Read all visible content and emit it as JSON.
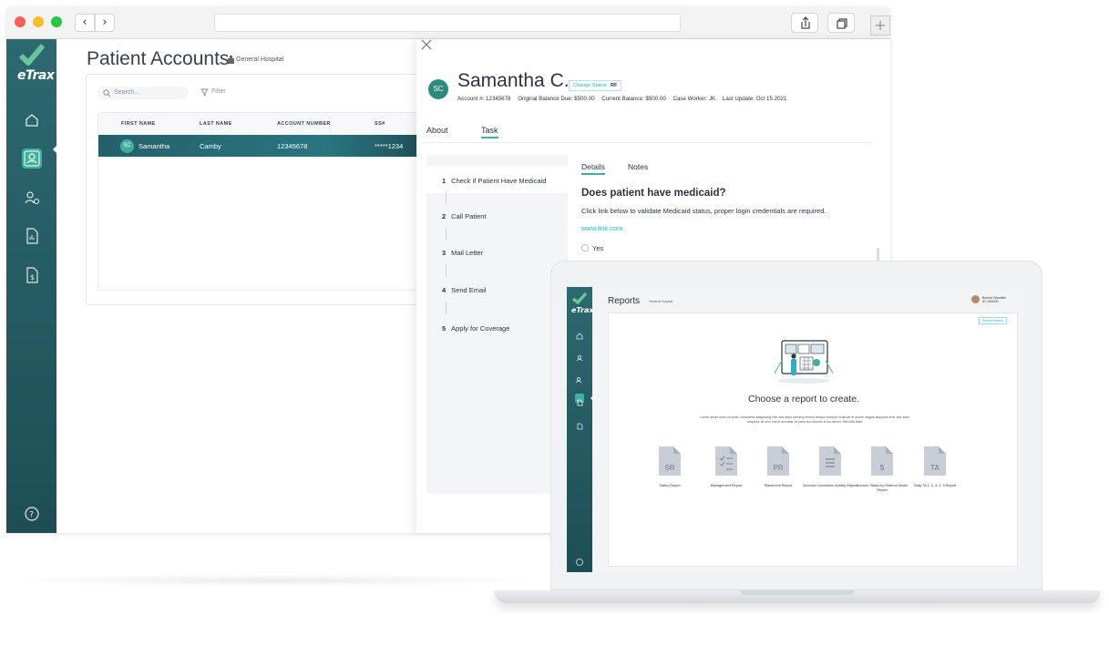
{
  "browser": {
    "url": "",
    "back_label": "‹",
    "forward_label": "›",
    "newtab_label": "+"
  },
  "sidebar": {
    "logo": "eTrax",
    "items": [
      {
        "icon": "home-icon"
      },
      {
        "icon": "patients-icon",
        "active": true
      },
      {
        "icon": "user-settings-icon"
      },
      {
        "icon": "report-doc-icon"
      },
      {
        "icon": "billing-doc-icon"
      },
      {
        "icon": "help-icon"
      }
    ]
  },
  "accounts": {
    "title": "Patient Accounts",
    "hospital": "General Hospital",
    "search_placeholder": "Search...",
    "filter_label": "Filter",
    "columns": [
      "FIRST NAME",
      "LAST NAME",
      "ACCOUNT NUMBER",
      "SS#"
    ],
    "rows": [
      {
        "initials": "SC",
        "first": "Samantha",
        "last": "Camby",
        "account": "12345678",
        "ssn": "*****1234"
      }
    ]
  },
  "patient": {
    "initials": "SC",
    "name": "Samantha C.",
    "change_status_label": "Change Status : ",
    "status_code": "RF",
    "account": "Account #: 12345678",
    "original_due": "Original Balance Due: $500.00",
    "current_balance": "Current Balance: $500.00",
    "case_worker": "Case Worker: JK",
    "last_update": "Last Update: Oct 15 2021",
    "tabs": [
      "About",
      "Task"
    ],
    "active_tab": "Task"
  },
  "tasks": [
    {
      "num": "1",
      "label": "Check if Patient Have Medicaid"
    },
    {
      "num": "2",
      "label": "Call Patient"
    },
    {
      "num": "3",
      "label": "Mail Letter"
    },
    {
      "num": "4",
      "label": "Send Email"
    },
    {
      "num": "5",
      "label": "Apply for Coverage"
    }
  ],
  "details": {
    "tabs": [
      "Details",
      "Notes"
    ],
    "question": "Does patient have medicaid?",
    "description": "Click link below to validate Medicaid status, proper login credentials are required.",
    "link": "www.link.com",
    "option_yes": "Yes"
  },
  "laptop": {
    "logo": "eTrax",
    "title": "Reports",
    "hospital": "General Hospital",
    "user_name": "Bonnie Woodkin",
    "user_id": "ID: 000000",
    "history_button": "Report History",
    "headline": "Choose a report to create.",
    "lorem": "Lorem ipsum dolor sit amet, consetetur sadipscing elitr, sed diam nonumy eirmod tempor invidunt ut labore et dolore magna aliquyam erat, sed diam voluptua. At vero eos et accusam et justo duo dolores et ea rebum. Stet clita kasd",
    "reports": [
      {
        "badge": "SR",
        "name": "Status Report",
        "icon": "status-report-icon"
      },
      {
        "badge": "",
        "name": "Management Report",
        "icon": "management-report-icon"
      },
      {
        "badge": "PR",
        "name": "Placement Report",
        "icon": "placement-report-icon"
      },
      {
        "badge": "",
        "name": "Account Conversion Activity Report",
        "icon": "conversion-report-icon"
      },
      {
        "badge": "$",
        "name": "Account Status by Referral Month Report",
        "icon": "referral-report-icon"
      },
      {
        "badge": "TA",
        "name": "Daily TA 1, 2, 3, 4, 5 Report",
        "icon": "daily-ta-report-icon"
      }
    ]
  },
  "colors": {
    "sidebar": "#235c63",
    "accent": "#3eb09b",
    "link": "#2fb0c2",
    "text": "#2b3440"
  }
}
